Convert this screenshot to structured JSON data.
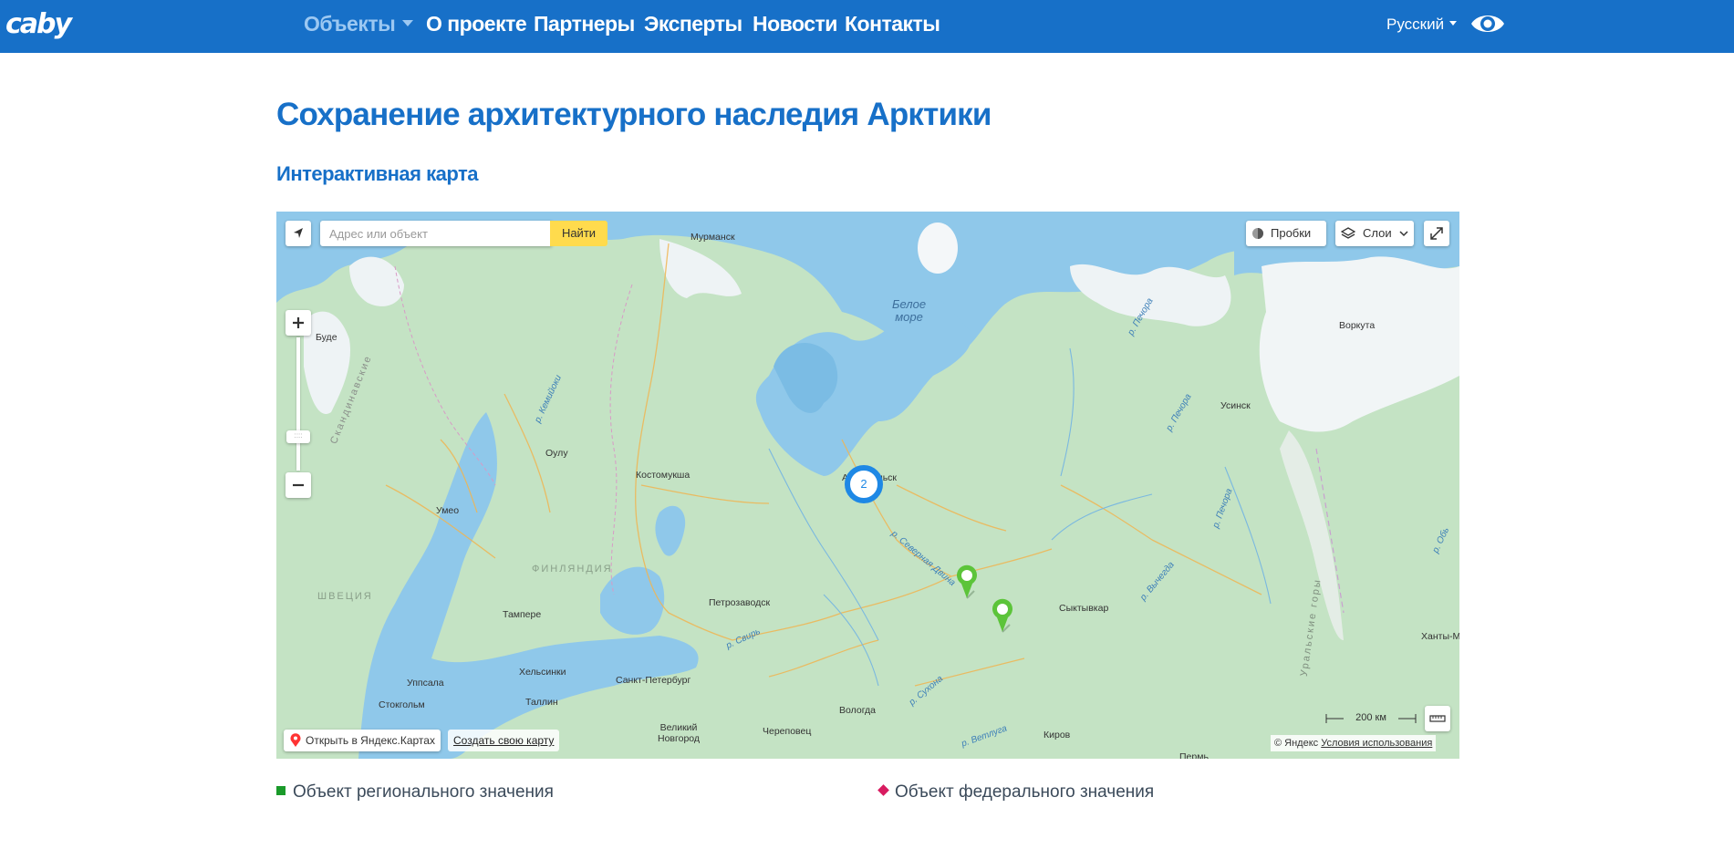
{
  "navbar": {
    "logo": "caby",
    "items": [
      {
        "label": "Объекты",
        "active": true,
        "dropdown": true
      },
      {
        "label": "О проекте"
      },
      {
        "label": "Партнеры"
      },
      {
        "label": "Эксперты"
      },
      {
        "label": "Новости"
      },
      {
        "label": "Контакты"
      }
    ],
    "language": "Русский",
    "accessibility_icon": "eye-icon",
    "colors": {
      "background": "#1770c8",
      "active": "#9cc8f2"
    }
  },
  "page": {
    "title": "Сохранение архитектурного наследия Арктики",
    "section_title": "Интерактивная карта"
  },
  "map": {
    "search_placeholder": "Адрес или объект",
    "search_button": "Найти",
    "traffic_button": "Пробки",
    "layers_button": "Слои",
    "zoom_handle": "::::",
    "scale_label": "200 км",
    "open_in_yandex": "Открыть в Яндекс.Картах",
    "create_map": "Создать свою карту",
    "copyright": "© Яндекс",
    "terms": "Условия использования",
    "cluster_count": "2",
    "labels": {
      "murmansk": "Мурманск",
      "white_sea": "Белое\nморе",
      "vorkuta": "Воркута",
      "usinsk": "Усинск",
      "bude": "Буде",
      "scandinavian": "Скандинавские",
      "oulu": "Оулу",
      "kostomuksha": "Костомукша",
      "arkhangelsk": "Архангельск",
      "umeo": "Умео",
      "finland": "ФИНЛЯНДИЯ",
      "sweden": "ШВЕЦИЯ",
      "tampere": "Тампере",
      "petrozavodsk": "Петрозаводск",
      "syktyvkar": "Сыктывкар",
      "helsinki": "Хельсинки",
      "st_petersburg": "Санкт-Петербург",
      "uppsala": "Уппсала",
      "stockholm": "Стокгольм",
      "tallinn": "Таллин",
      "vologda": "Вологда",
      "cherepovets": "Череповец",
      "veliky_novgorod": "Великий\nНовгород",
      "kirov": "Киров",
      "khanty": "Ханты-М",
      "perm": "Пермь",
      "ural": "Уральские горы",
      "river_pechora": "р. Печора",
      "river_pechora2": "р. Печора",
      "river_pechora3": "р. Печора",
      "river_sev_dvina": "р. Северная Двина",
      "river_vychegda": "р. Вычегда",
      "river_sukhona": "р. Сухона",
      "river_vetluga": "р. Ветлуга",
      "river_svir": "р. Свирь",
      "river_kem": "р. Кемийоки",
      "river_ob": "р. Обь"
    },
    "colors": {
      "land": "#bfe0c1",
      "water": "#8fc8ea",
      "snow": "#f4f7f9",
      "road": "#f0b552",
      "pin": "#5cc43a",
      "cluster": "#1e88e5",
      "search_button": "#ffdb4d"
    }
  },
  "legend": {
    "regional": {
      "label": "Объект регионального значения",
      "color": "#1a9a2a"
    },
    "federal": {
      "label": "Объект федерального значения",
      "color": "#d81b60"
    }
  }
}
